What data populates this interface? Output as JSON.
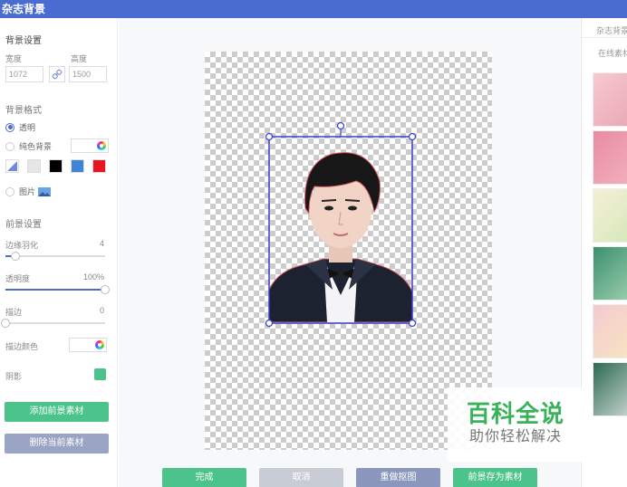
{
  "window": {
    "title": "杂志背景"
  },
  "left": {
    "bg_settings_title": "背景设置",
    "width_label": "宽度",
    "height_label": "高度",
    "width_value": "1072",
    "height_value": "1500",
    "bg_format_title": "背景格式",
    "opt_transparent": "透明",
    "opt_solid": "纯色背景",
    "opt_image": "图片",
    "swatches": [
      "#e6e6e6",
      "#000000",
      "#3d86d6",
      "#e8141e"
    ],
    "fg_settings_title": "前景设置",
    "feather_label": "边缘羽化",
    "feather_value": "4",
    "feather_fraction": 0.1,
    "opacity_label": "透明度",
    "opacity_value": "100%",
    "opacity_fraction": 1.0,
    "stroke_label": "描边",
    "stroke_value": "0",
    "stroke_fraction": 0.0,
    "stroke_color_label": "描边颜色",
    "shadow_label": "阴影",
    "shadow_color": "#4cc38a",
    "add_fg_button": "添加前景素材",
    "delete_fg_button": "删除当前素材"
  },
  "bottom": {
    "done": "完成",
    "cancel": "取消",
    "redo_cutout": "重做抠图",
    "save_fg": "前景存为素材"
  },
  "right": {
    "title": "杂志背景",
    "subtitle": "在线素材"
  },
  "watermark": {
    "main": "百科全说",
    "sub": "助你轻松解决"
  },
  "colors": {
    "accent": "#4a6bd0",
    "green": "#4cc38a"
  }
}
